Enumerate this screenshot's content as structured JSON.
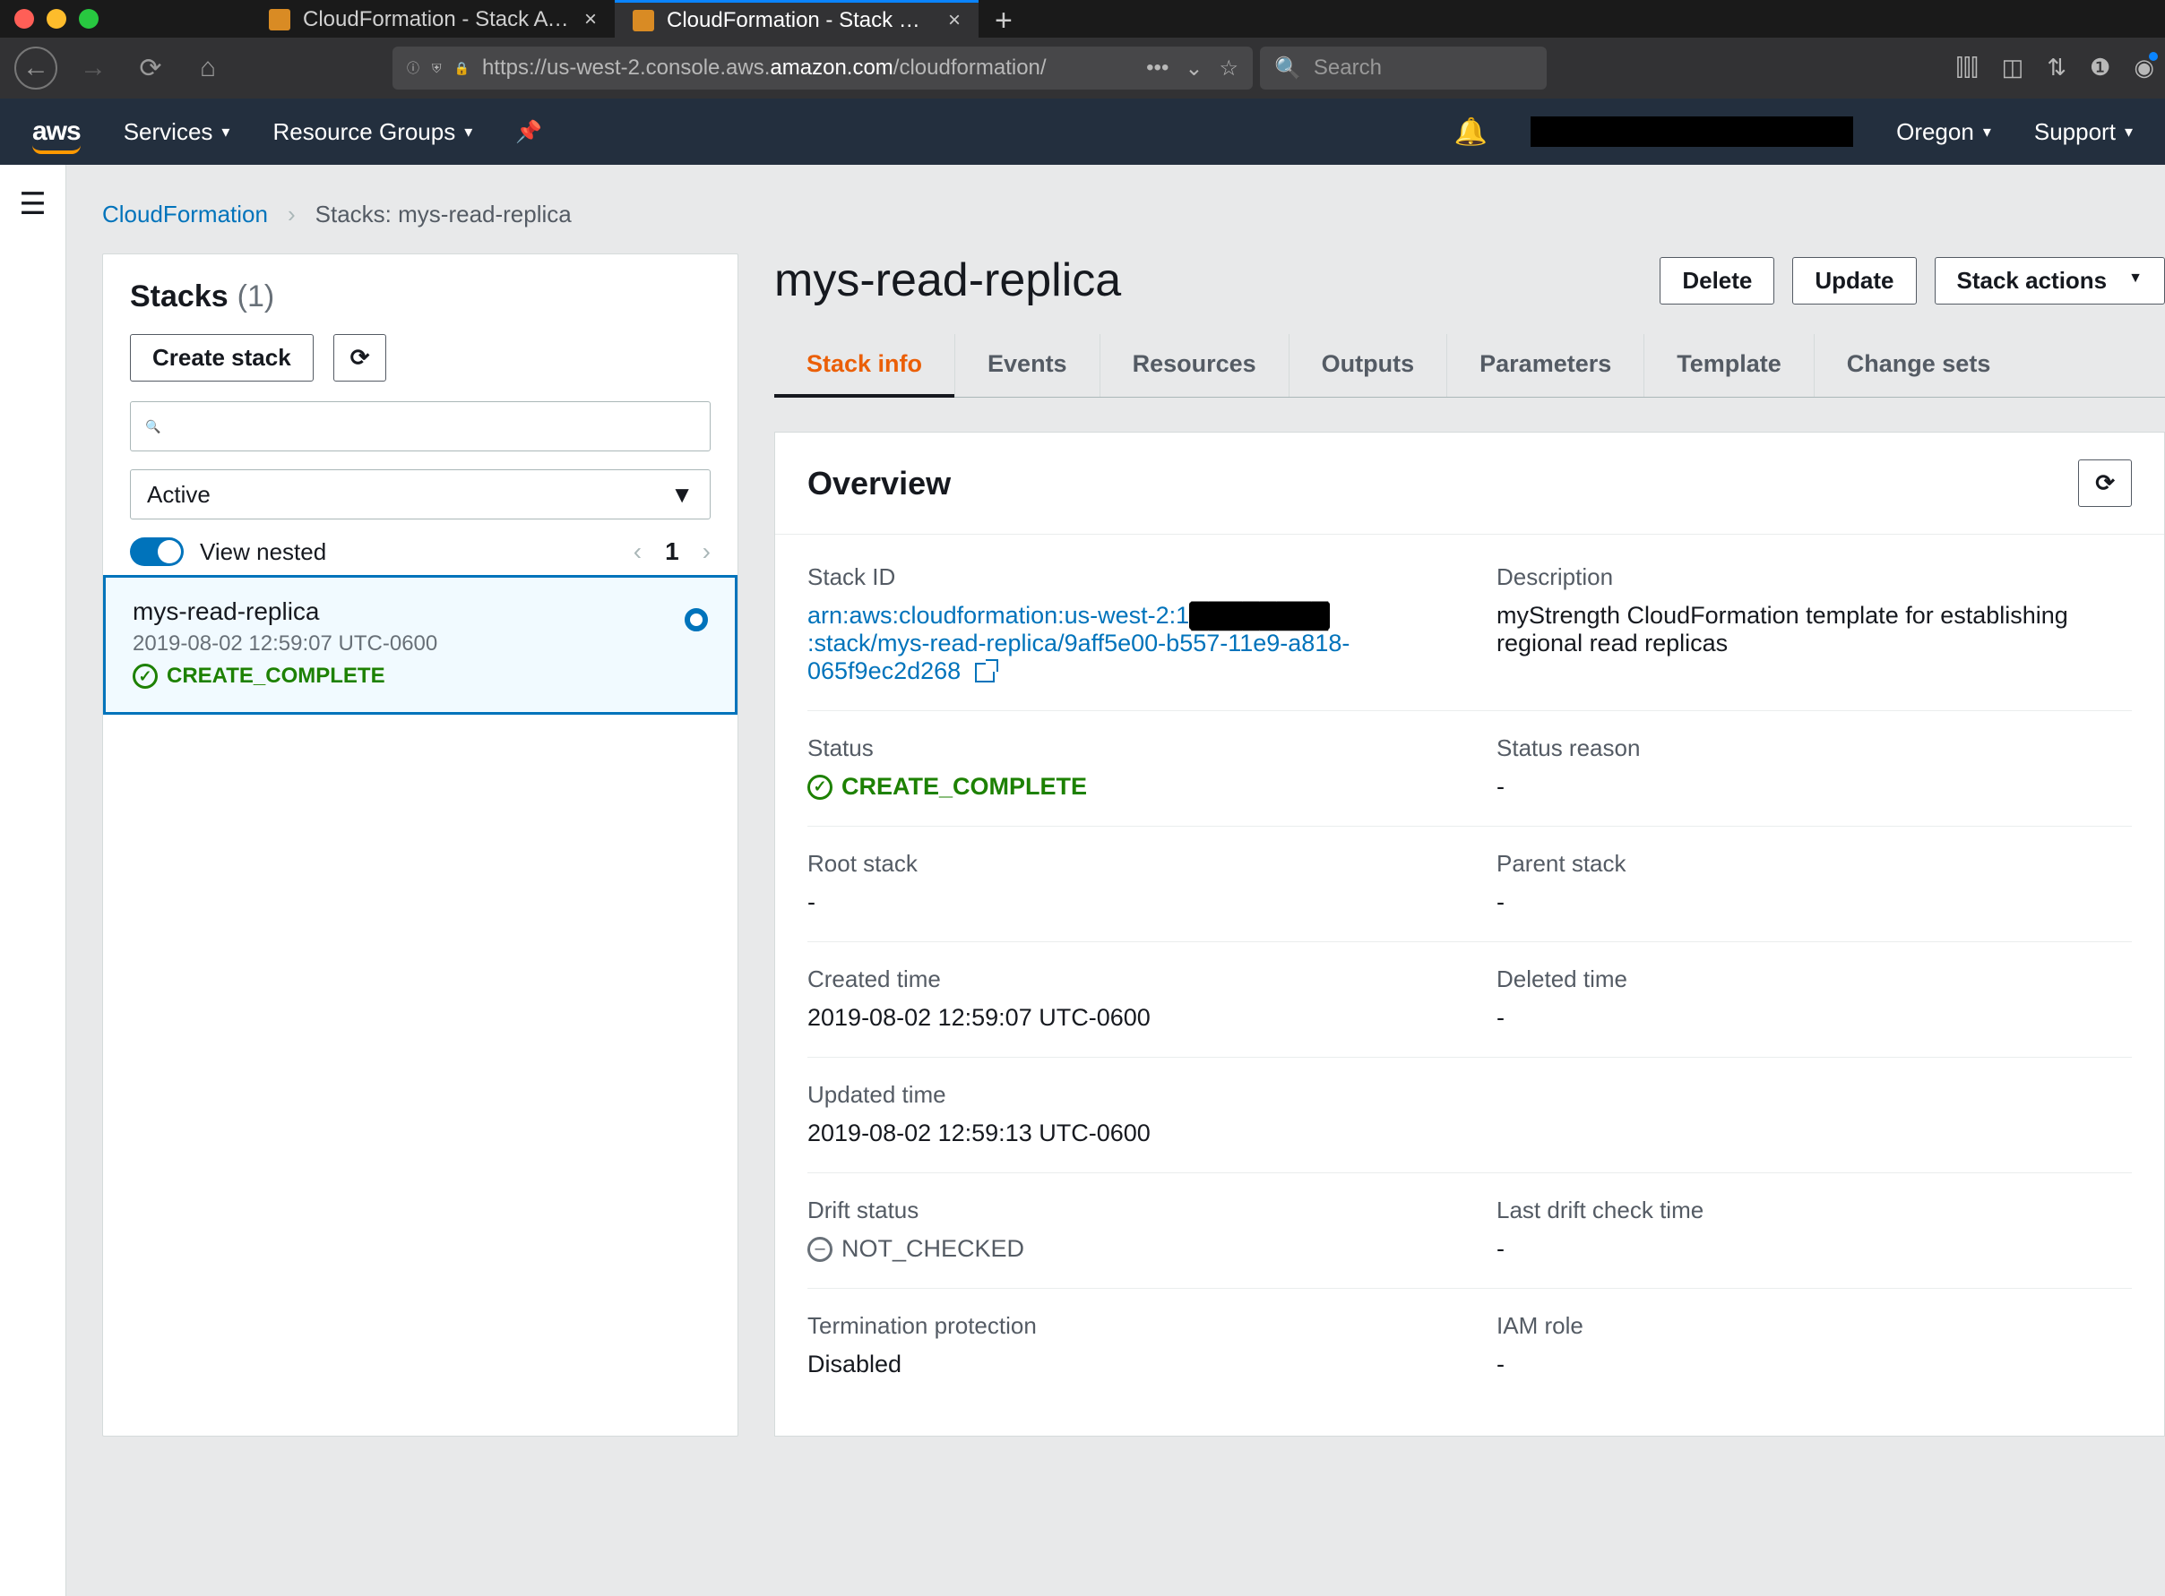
{
  "browser": {
    "tabs": [
      {
        "title": "CloudFormation - Stack AWSC",
        "active": false
      },
      {
        "title": "CloudFormation - Stack mys-re",
        "active": true
      }
    ],
    "url_prefix": "https://us-west-2.console.aws.",
    "url_strong": "amazon.com",
    "url_suffix": "/cloudformation/",
    "search_placeholder": "Search"
  },
  "aws_nav": {
    "services": "Services",
    "resource_groups": "Resource Groups",
    "region": "Oregon",
    "support": "Support"
  },
  "breadcrumbs": {
    "root": "CloudFormation",
    "current": "Stacks: mys-read-replica"
  },
  "left": {
    "heading": "Stacks",
    "count": "(1)",
    "create_label": "Create stack",
    "filter_value": "Active",
    "view_nested": "View nested",
    "page": "1",
    "stack": {
      "name": "mys-read-replica",
      "timestamp": "2019-08-02 12:59:07 UTC-0600",
      "status": "CREATE_COMPLETE"
    }
  },
  "right": {
    "title": "mys-read-replica",
    "buttons": {
      "delete": "Delete",
      "update": "Update",
      "actions": "Stack actions"
    },
    "tabs": [
      "Stack info",
      "Events",
      "Resources",
      "Outputs",
      "Parameters",
      "Template",
      "Change sets"
    ],
    "active_tab": 0,
    "overview_title": "Overview",
    "fields": {
      "stack_id_label": "Stack ID",
      "stack_id_pre": "arn:aws:cloudformation:us-west-2:1",
      "stack_id_post": ":stack/mys-read-replica/9aff5e00-b557-11e9-a818-065f9ec2d268",
      "description_label": "Description",
      "description_value": "myStrength CloudFormation template for establishing regional read replicas",
      "status_label": "Status",
      "status_value": "CREATE_COMPLETE",
      "status_reason_label": "Status reason",
      "status_reason_value": "-",
      "root_label": "Root stack",
      "root_value": "-",
      "parent_label": "Parent stack",
      "parent_value": "-",
      "created_label": "Created time",
      "created_value": "2019-08-02 12:59:07 UTC-0600",
      "deleted_label": "Deleted time",
      "deleted_value": "-",
      "updated_label": "Updated time",
      "updated_value": "2019-08-02 12:59:13 UTC-0600",
      "drift_label": "Drift status",
      "drift_value": "NOT_CHECKED",
      "drift_time_label": "Last drift check time",
      "drift_time_value": "-",
      "term_label": "Termination protection",
      "term_value": "Disabled",
      "iam_label": "IAM role",
      "iam_value": "-"
    }
  }
}
